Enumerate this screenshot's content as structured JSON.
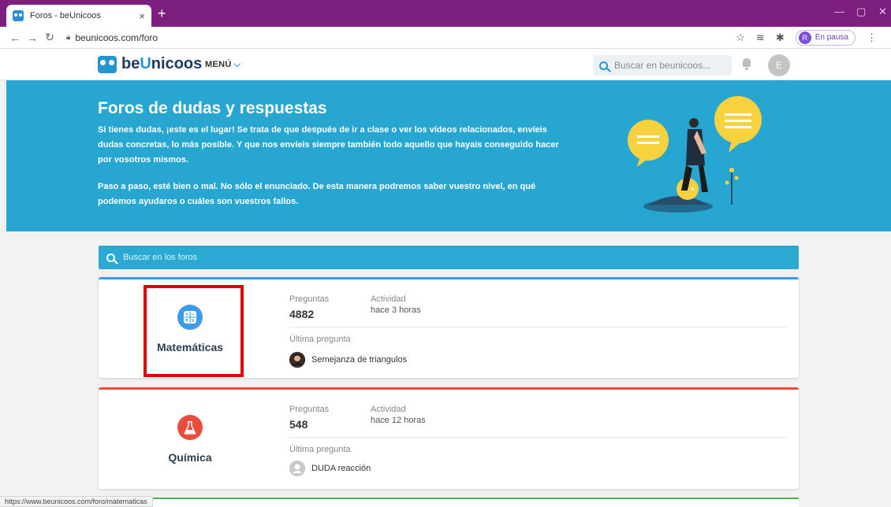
{
  "browser": {
    "tab_title": "Foros - beUnicoos",
    "tab_close": "×",
    "new_tab": "+",
    "url": "beunicoos.com/foro",
    "profile_initial": "R",
    "profile_status": "En pausa",
    "status_url": "https://www.beunicoos.com/foro/matematicas"
  },
  "header": {
    "logo_be": "be",
    "logo_u": "U",
    "logo_rest": "nicoos",
    "menu_label": "MENÚ",
    "search_placeholder": "Buscar en beunicoos...",
    "avatar_initial": "E"
  },
  "hero": {
    "title": "Foros de dudas y respuestas",
    "paragraph1": "Si tienes dudas, ¡este es el lugar! Se trata de que después de ir a clase o ver los vídeos relacionados, envíeis dudas concretas, lo más posible. Y que nos envíeis siempre también todo aquello que hayais conseguido hacer por vosotros mismos.",
    "paragraph2": "Paso a paso, esté bien o mal. No sólo el enunciado. De esta manera podremos saber vuestro nivel, en qué podemos ayudaros o cuáles son vuestros fallos."
  },
  "forum_search": {
    "placeholder": "Buscar en los foros"
  },
  "forums": [
    {
      "name": "Matemáticas",
      "questions_label": "Preguntas",
      "questions": "4882",
      "activity_label": "Actividad",
      "activity": "hace 3 horas",
      "last_label": "Última pregunta",
      "last_question": "Semejanza de triangulos",
      "accent": "#3d9be9",
      "icon": "calculator-icon"
    },
    {
      "name": "Química",
      "questions_label": "Preguntas",
      "questions": "548",
      "activity_label": "Actividad",
      "activity": "hace 12 horas",
      "last_label": "Última pregunta",
      "last_question": "DUDA reacción",
      "accent": "#e74c3c",
      "icon": "flask-icon"
    }
  ]
}
